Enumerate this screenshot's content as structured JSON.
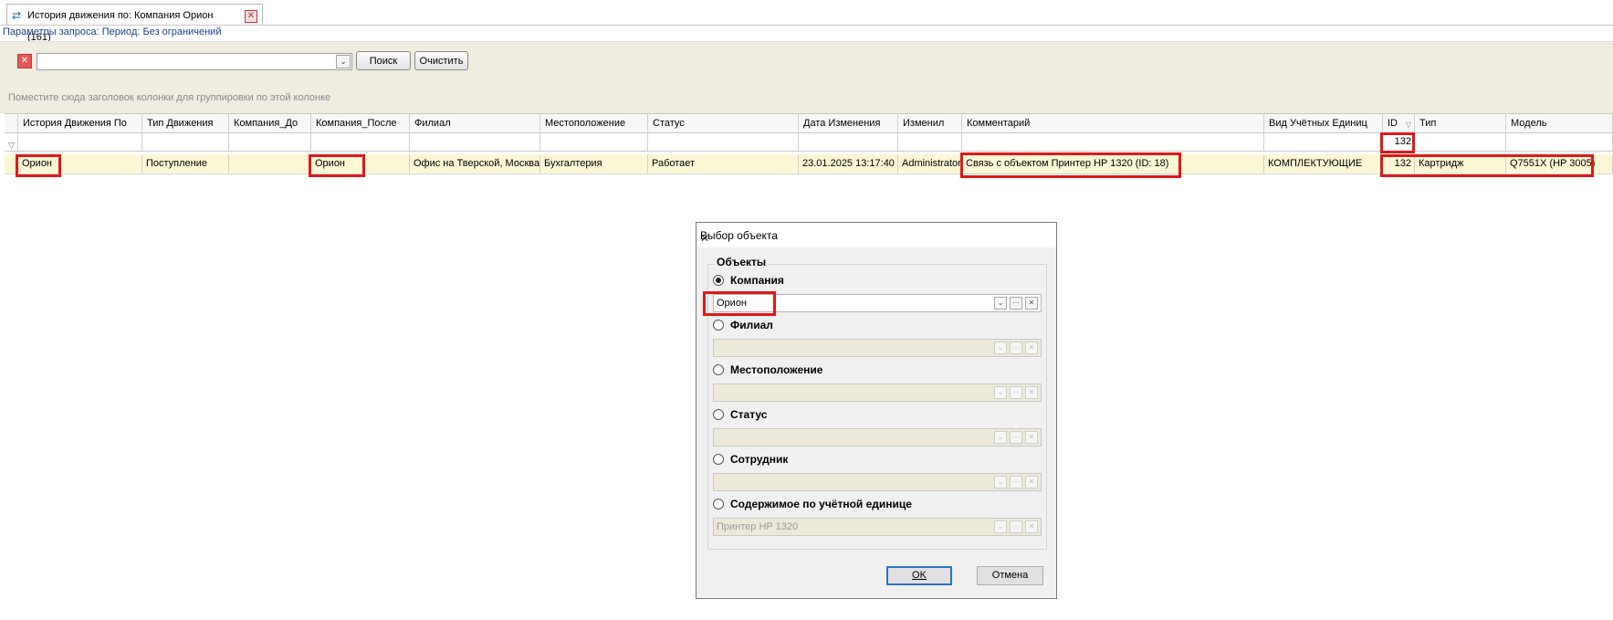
{
  "tab": {
    "title": "История движения по: Компания Орион (161)"
  },
  "params": "Параметры запроса: Период: Без ограничений",
  "toolbar": {
    "combo_value": "",
    "search": "Поиск",
    "clear": "Очистить"
  },
  "group_hint": "Поместите сюда заголовок колонки для группировки по этой колонке",
  "grid": {
    "columns": [
      "История Движения По",
      "Тип Движения",
      "Компания_До",
      "Компания_После",
      "Филиал",
      "Местоположение",
      "Статус",
      "Дата Изменения",
      "Изменил",
      "Комментарий",
      "Вид Учётных Единиц",
      "ID",
      "Тип",
      "Модель"
    ],
    "filter": {
      "id": "132"
    },
    "rows": [
      [
        "Орион",
        "Поступление",
        "",
        "Орион",
        "Офис на Тверской, Москва",
        "Бухгалтерия",
        "Работает",
        "23.01.2025 13:17:40",
        "Administrator",
        "Связь с объектом Принтер HP 1320 (ID: 18)",
        "КОМПЛЕКТУЮЩИЕ",
        "132",
        "Картридж",
        "Q7551X (HP 3005)"
      ]
    ]
  },
  "dialog": {
    "title": "Выбор объекта",
    "group": "Объекты",
    "options": [
      {
        "label": "Компания",
        "selected": true,
        "value": "Орион"
      },
      {
        "label": "Филиал",
        "selected": false,
        "value": ""
      },
      {
        "label": "Местоположение",
        "selected": false,
        "value": ""
      },
      {
        "label": "Статус",
        "selected": false,
        "value": ""
      },
      {
        "label": "Сотрудник",
        "selected": false,
        "value": ""
      },
      {
        "label": "Содержимое по учётной единице",
        "selected": false,
        "value": "Принтер HP 1320"
      }
    ],
    "ok": "OK",
    "cancel": "Отмена"
  },
  "colors": {
    "highlight": "#e01818",
    "row_bg": "#fbf7d4",
    "toolbar_bg": "#efece0"
  }
}
